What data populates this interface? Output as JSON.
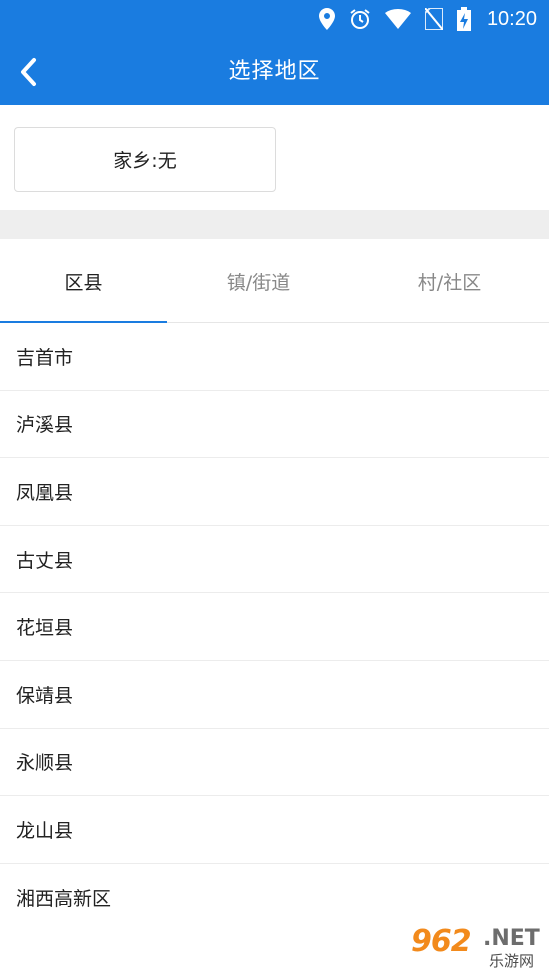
{
  "status_bar": {
    "time": "10:20",
    "icons": [
      "location-icon",
      "alarm-icon",
      "wifi-icon",
      "no-sim-icon",
      "battery-charging-icon"
    ]
  },
  "app_bar": {
    "back_icon": "chevron-left-icon",
    "title": "选择地区"
  },
  "hometown": {
    "label": "家乡:无"
  },
  "tabs": [
    {
      "label": "区县",
      "active": true
    },
    {
      "label": "镇/街道",
      "active": false
    },
    {
      "label": "村/社区",
      "active": false
    }
  ],
  "districts": [
    "吉首市",
    "泸溪县",
    "凤凰县",
    "古丈县",
    "花垣县",
    "保靖县",
    "永顺县",
    "龙山县",
    "湘西高新区"
  ],
  "watermark": {
    "number": "962",
    "suffix": ".NET",
    "sub": "乐游网"
  },
  "colors": {
    "primary": "#1a7ce0",
    "divider": "#ececec",
    "band": "#eeeeee",
    "inactive_tab": "#888888"
  }
}
